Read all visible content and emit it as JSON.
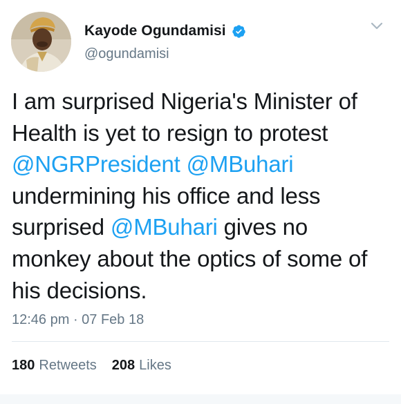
{
  "author": {
    "name": "Kayode Ogundamisi",
    "handle": "@ogundamisi",
    "verified": true,
    "avatar_icon": "profile-photo"
  },
  "menu_icon": "chevron-down-icon",
  "tweet": {
    "segments": [
      {
        "text": "I am surprised Nigeria's Minister of Health is yet to resign to protest ",
        "type": "text"
      },
      {
        "text": "@NGRPresident",
        "type": "mention"
      },
      {
        "text": " ",
        "type": "text"
      },
      {
        "text": "@MBuhari",
        "type": "mention"
      },
      {
        "text": " undermining his office and less surprised ",
        "type": "text"
      },
      {
        "text": "@MBuhari",
        "type": "mention"
      },
      {
        "text": " gives no monkey about the optics of some of his decisions.",
        "type": "text"
      }
    ],
    "timestamp": "12:46 pm · 07 Feb 18"
  },
  "stats": {
    "retweets_count": "180",
    "retweets_label": "Retweets",
    "likes_count": "208",
    "likes_label": "Likes"
  },
  "colors": {
    "mention": "#1da1f2",
    "verified": "#1da1f2",
    "secondary_text": "#657786"
  }
}
